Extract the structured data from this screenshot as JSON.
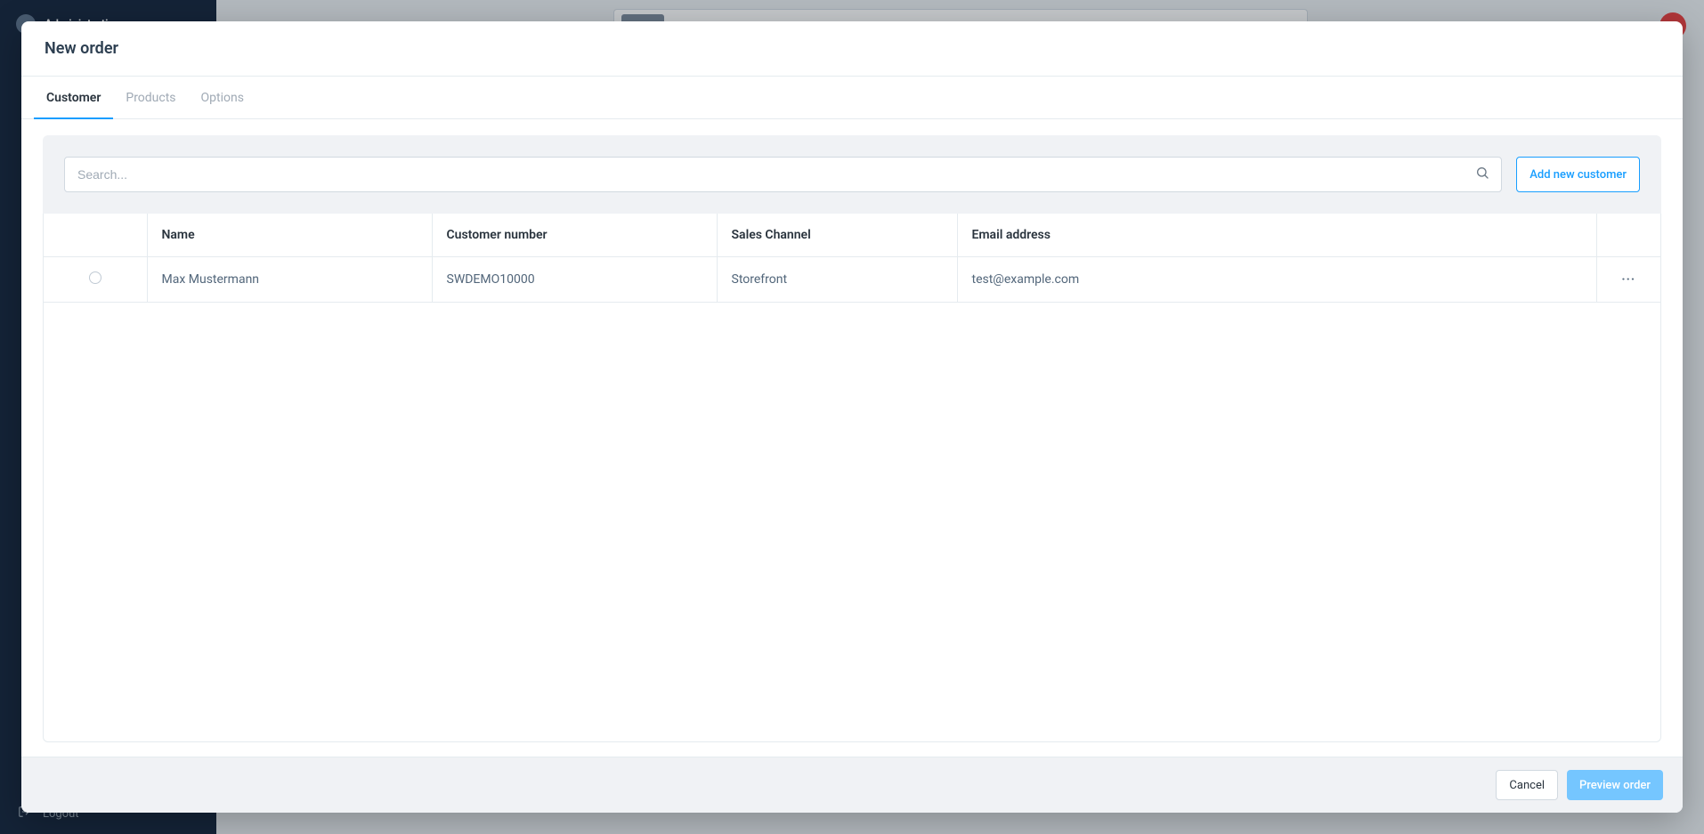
{
  "background": {
    "app_title": "Administration",
    "logout_label": "Logout"
  },
  "modal": {
    "title": "New order",
    "tabs": {
      "customer": "Customer",
      "products": "Products",
      "options": "Options"
    },
    "search": {
      "placeholder": "Search..."
    },
    "add_customer_label": "Add new customer",
    "table": {
      "headers": {
        "name": "Name",
        "customer_number": "Customer number",
        "sales_channel": "Sales Channel",
        "email": "Email address"
      },
      "rows": [
        {
          "name": "Max Mustermann",
          "customer_number": "SWDEMO10000",
          "sales_channel": "Storefront",
          "email": "test@example.com"
        }
      ]
    },
    "footer": {
      "cancel": "Cancel",
      "preview": "Preview order"
    }
  }
}
